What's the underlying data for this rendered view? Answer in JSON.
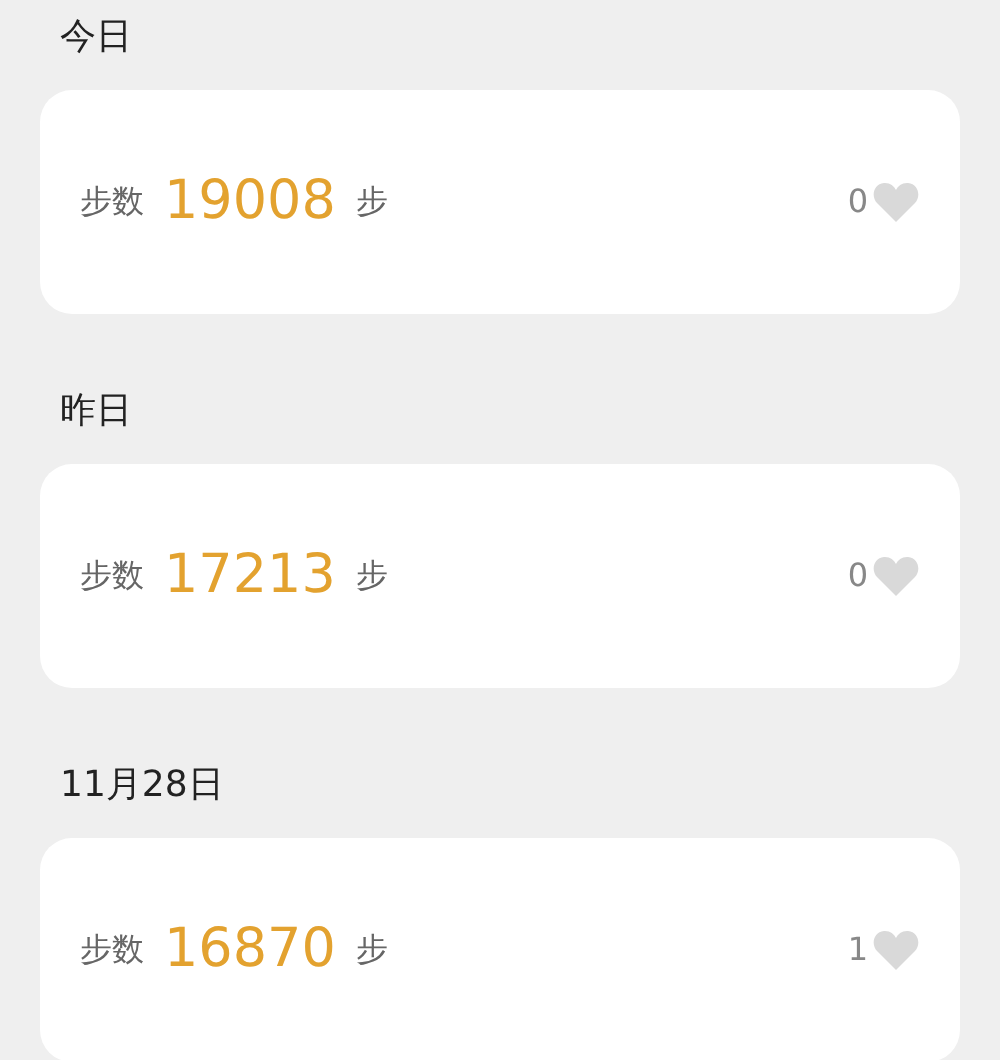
{
  "days": [
    {
      "label": "今日",
      "steps_label": "步数",
      "steps": "19008",
      "unit": "步",
      "likes": "0",
      "liked": false
    },
    {
      "label": "昨日",
      "steps_label": "步数",
      "steps": "17213",
      "unit": "步",
      "likes": "0",
      "liked": false
    },
    {
      "label": "11月28日",
      "steps_label": "步数",
      "steps": "16870",
      "unit": "步",
      "likes": "1",
      "liked": false
    }
  ]
}
